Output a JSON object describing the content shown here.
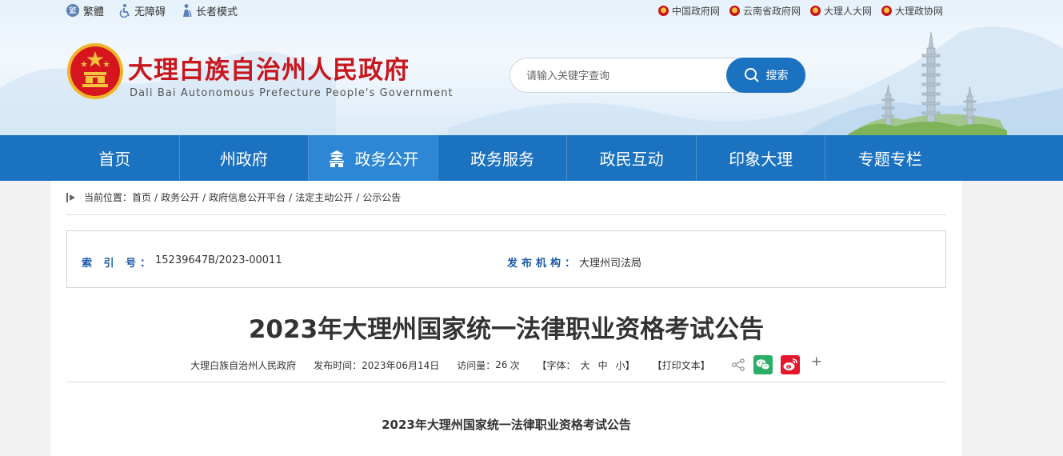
{
  "topbar": {
    "left": [
      {
        "label": "繁體",
        "icon": "traditional-chinese-icon"
      },
      {
        "label": "无障碍",
        "icon": "accessibility-icon"
      },
      {
        "label": "长者模式",
        "icon": "elder-mode-icon"
      }
    ],
    "right": [
      {
        "label": "中国政府网"
      },
      {
        "label": "云南省政府网"
      },
      {
        "label": "大理人大网"
      },
      {
        "label": "大理政协网"
      }
    ]
  },
  "header": {
    "title": "大理白族自治州人民政府",
    "subtitle": "Dali Bai Autonomous Prefecture People's Government"
  },
  "search": {
    "placeholder": "请输入关键字查询",
    "button_label": "搜索"
  },
  "nav": {
    "items": [
      {
        "label": "首页",
        "active": false
      },
      {
        "label": "州政府",
        "active": false
      },
      {
        "label": "政务公开",
        "active": true
      },
      {
        "label": "政务服务",
        "active": false
      },
      {
        "label": "政民互动",
        "active": false
      },
      {
        "label": "印象大理",
        "active": false
      },
      {
        "label": "专题专栏",
        "active": false
      }
    ]
  },
  "breadcrumb": {
    "label": "当前位置：",
    "items": [
      "首页",
      "政务公开",
      "政府信息公开平台",
      "法定主动公开",
      "公示公告"
    ],
    "separator": "/"
  },
  "meta": {
    "index_label": "索 引 号：",
    "index_value": "15239647B/2023-00011",
    "org_label": "发布机构：",
    "org_value": "大理州司法局"
  },
  "article": {
    "title": "2023年大理州国家统一法律职业资格考试公告",
    "source": "大理白族自治州人民政府",
    "publish_label": "发布时间：",
    "publish_date": "2023年06月14日",
    "views_label": "访问量：",
    "views_count": "26",
    "views_unit": "次",
    "font_open": "【字体：",
    "font_large": "大",
    "font_medium": "中",
    "font_small": "小",
    "font_close": "】",
    "print_label": "【打印文本】",
    "plus": "+",
    "sub_title": "2023年大理州国家统一法律职业资格考试公告"
  },
  "colors": {
    "brand_blue": "#1b72c0",
    "nav_active": "#2d87d4",
    "title_red": "#c8161d",
    "meta_label_blue": "#1b5aa8",
    "wechat_green": "#2aae67",
    "weibo_red": "#e6162d"
  }
}
